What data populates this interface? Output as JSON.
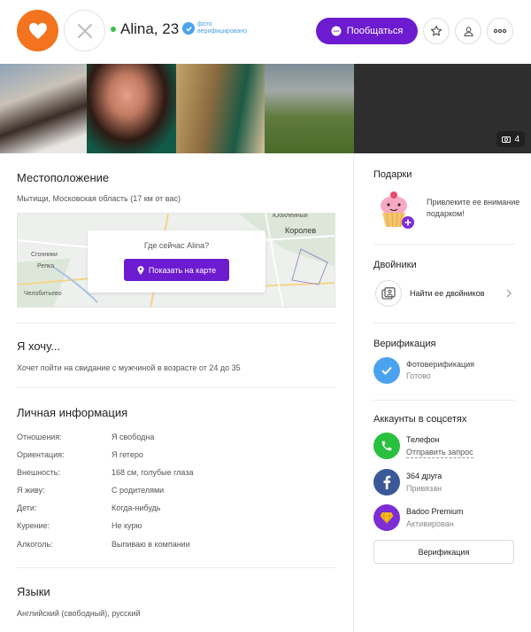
{
  "header": {
    "name": "Alina, 23",
    "verified_text": "фото верифицировано",
    "chat_label": "Пообщаться"
  },
  "photos": {
    "count": "4"
  },
  "location": {
    "title": "Местоположение",
    "text": "Мытищи, Московская область (17 км от вас)",
    "map_question": "Где сейчас Alina?",
    "map_button": "Показать на карте",
    "map_labels": [
      "Юбилейный",
      "Королев",
      "Сгонники",
      "Репка",
      "Челобитьево"
    ]
  },
  "want": {
    "title": "Я хочу...",
    "text": "Хочет пойти на свидание с мужчиной в возрасте от 24 до 35"
  },
  "personal": {
    "title": "Личная информация",
    "rows": [
      {
        "label": "Отношения:",
        "value": "Я свободна"
      },
      {
        "label": "Ориентация:",
        "value": "Я гетеро"
      },
      {
        "label": "Внешность:",
        "value": "168 см, голубые глаза"
      },
      {
        "label": "Я живу:",
        "value": "С родителями"
      },
      {
        "label": "Дети:",
        "value": "Когда-нибудь"
      },
      {
        "label": "Курение:",
        "value": "Не курю"
      },
      {
        "label": "Алкоголь:",
        "value": "Выпиваю в компании"
      }
    ]
  },
  "languages": {
    "title": "Языки",
    "text": "Английский (свободный), русский"
  },
  "sidebar": {
    "gifts_title": "Подарки",
    "gifts_text": "Привлеките ее внимание подарком!",
    "twins_title": "Двойники",
    "twins_link": "Найти ее двойников",
    "verification_title": "Верификация",
    "photo_verif": "Фотоверификация",
    "photo_verif_status": "Готово",
    "social_title": "Аккаунты в соцсетях",
    "phone": "Телефон",
    "phone_action": "Отправить запрос",
    "facebook": "364 друга",
    "facebook_status": "Привязан",
    "premium": "Badoo Premium",
    "premium_status": "Активирован",
    "verification_button": "Верификация"
  },
  "colors": {
    "like": "#f3731e",
    "accent": "#6d1bd0",
    "verified": "#4ba3ef",
    "online": "#3cc050",
    "phone": "#28c03f",
    "facebook": "#3b5998",
    "premium": "#7c2dd4"
  }
}
